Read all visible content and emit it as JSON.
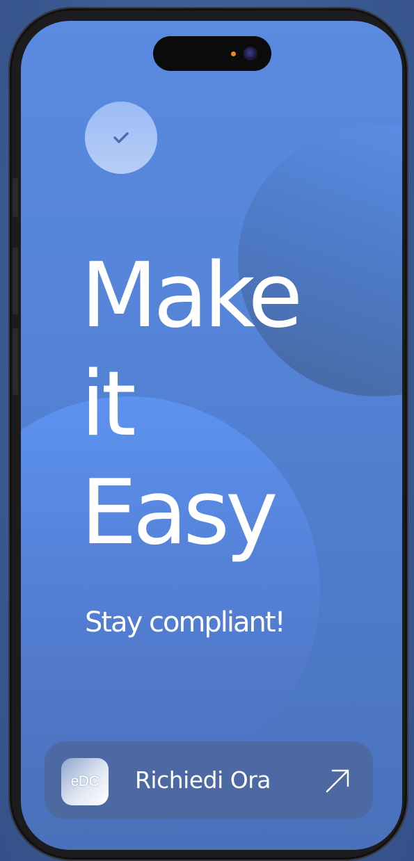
{
  "hero": {
    "headline_lines": [
      "Make",
      "it",
      "Easy"
    ],
    "subtitle": "Stay compliant!"
  },
  "cta": {
    "logo_text": "eDC",
    "label": "Richiedi Ora"
  },
  "colors": {
    "background": "#3f5f97",
    "screen_top": "#5a8be0",
    "screen_bottom": "#4a72bb",
    "check_badge": "#b6cdf6",
    "check_mark": "#4a6fb0",
    "cta_background": "#4e679e",
    "text": "#ffffff"
  },
  "icons": {
    "badge": "check-icon",
    "cta_action": "arrow-up-right-icon"
  }
}
